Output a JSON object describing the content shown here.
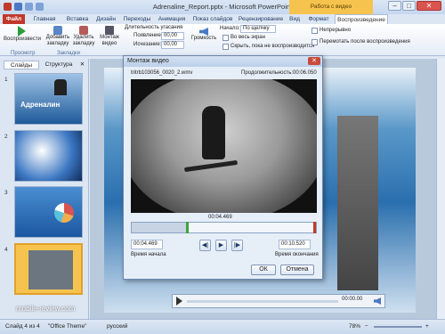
{
  "window": {
    "title": "Adrenaline_Report.pptx - Microsoft PowerPoint",
    "context_tab": "Работа с видео",
    "minimize": "–",
    "maximize": "□",
    "close": "✕"
  },
  "tabs": [
    "Файл",
    "Главная",
    "Вставка",
    "Дизайн",
    "Переходы",
    "Анимация",
    "Показ слайдов",
    "Рецензирование",
    "Вид",
    "Формат",
    "Воспроизведение"
  ],
  "ribbon": {
    "play_label": "Воспроизвести",
    "add_bookmark_label": "Добавить закладку",
    "remove_bookmark_label": "Удалить закладку",
    "trim_label": "Монтаж видео",
    "fade_duration_label": "Длительность угасания",
    "fade_in_label": "Появление:",
    "fade_in_value": "00,00",
    "fade_out_label": "Исчезание:",
    "fade_out_value": "00,00",
    "volume_label": "Громкость",
    "start_label": "Начало:",
    "start_value": "По щелчку",
    "fullscreen_label": "Во весь экран",
    "hide_label": "Скрыть, пока не воспроизводится",
    "loop_label": "Непрерывно",
    "rewind_label": "Перемотать после воспроизведения",
    "group_preview": "Просмотр",
    "group_bookmarks": "Закладки"
  },
  "panel": {
    "tab_slides": "Слайды",
    "tab_outline": "Структура",
    "close": "✕",
    "slide1_title": "Адреналин",
    "slide_numbers": [
      "1",
      "2",
      "3",
      "4"
    ]
  },
  "dialog": {
    "title": "Монтаж видео",
    "close": "✕",
    "filename": "tritrb103056_0020_2.wmv",
    "duration_label": "Продолжительность:",
    "duration_value": "00:06.050",
    "current_time": "00:04.469",
    "start_time": "00:04.469",
    "end_time": "00:10.520",
    "start_label": "Время начала",
    "end_label": "Время окончания",
    "ok_label": "ОК",
    "cancel_label": "Отмена",
    "prev_frame": "◀|",
    "play": "▶",
    "next_frame": "|▶",
    "selection": {
      "start_fraction": 0.3,
      "end_fraction": 1.0
    }
  },
  "player": {
    "time": "00:00.00"
  },
  "watermark": "mobile-review.com",
  "status": {
    "slide": "Слайд 4 из 4",
    "theme": "\"Office Theme\"",
    "language": "русский",
    "zoom": "78%",
    "zoom_out": "−",
    "zoom_in": "+"
  },
  "colors": {
    "file_tab": "#c0392b",
    "context_tab": "#f6c44e",
    "accent": "#2a6fae"
  }
}
